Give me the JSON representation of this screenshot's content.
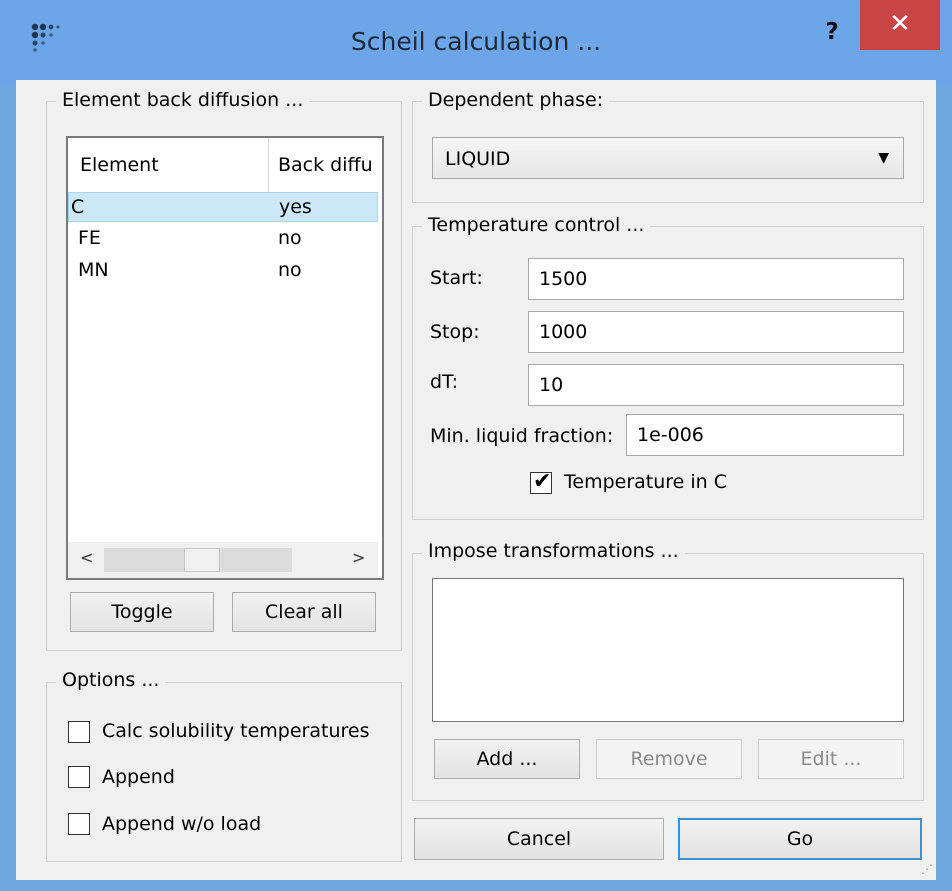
{
  "window": {
    "title": "Scheil calculation ...",
    "help_label": "?",
    "close_label": "✕",
    "icon": "app-dots-icon"
  },
  "element_back_diffusion": {
    "title": "Element back diffusion ...",
    "columns": [
      "Element",
      "Back diffu"
    ],
    "rows": [
      {
        "element": "C",
        "back_diffusion": "yes",
        "selected": true
      },
      {
        "element": "FE",
        "back_diffusion": "no"
      },
      {
        "element": "MN",
        "back_diffusion": "no"
      }
    ],
    "scroll_left": "<",
    "scroll_right": ">",
    "toggle_label": "Toggle",
    "clear_all_label": "Clear all"
  },
  "options": {
    "title": "Options ...",
    "calc_solubility_label": "Calc solubility temperatures",
    "append_label": "Append",
    "append_wo_load_label": "Append w/o load"
  },
  "dependent_phase": {
    "title": "Dependent phase:",
    "selected": "LIQUID",
    "arrow": "▼"
  },
  "temperature_control": {
    "title": "Temperature control ...",
    "start_label": "Start:",
    "start_value": "1500",
    "stop_label": "Stop:",
    "stop_value": "1000",
    "dt_label": "dT:",
    "dt_value": "10",
    "min_liquid_label": "Min. liquid fraction:",
    "min_liquid_value": "1e-006",
    "temp_in_c_label": "Temperature in C",
    "temp_in_c_checked": true,
    "check_glyph": "✔"
  },
  "impose_transformations": {
    "title": "Impose transformations ...",
    "add_label": "Add ...",
    "remove_label": "Remove",
    "edit_label": "Edit ..."
  },
  "footer": {
    "cancel_label": "Cancel",
    "go_label": "Go"
  },
  "colors": {
    "titlebar": "#6ca6e8",
    "close_button": "#c94444",
    "selection": "#cce8f6",
    "default_button_border": "#3b8fd6"
  }
}
